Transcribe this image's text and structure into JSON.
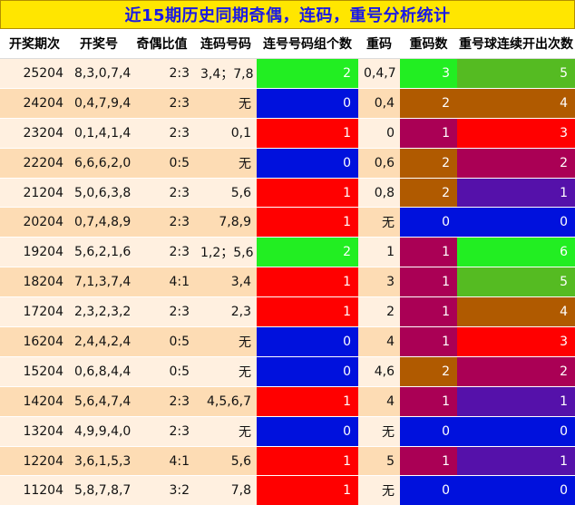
{
  "title": "近15期历史同期奇偶，连码，重号分析统计",
  "headers": [
    "开奖期次",
    "开奖号",
    "奇偶比值",
    "连码号码",
    "连号号码组个数",
    "重码",
    "重码数",
    "重号球连续开出次数"
  ],
  "colors": {
    "green": "#22ee22",
    "blue": "#0011dd",
    "red": "#ff0000",
    "brown": "#b05a00",
    "magenta": "#aa0055",
    "purple": "#5511aa",
    "lime": "#55bb22",
    "title_bg": "#ffe600",
    "title_text": "#1a1ae6"
  },
  "rows": [
    {
      "issue": "25204",
      "numbers": "8,3,0,7,4",
      "ratio": "2:3",
      "consec": "3,4；7,8",
      "groups": "2",
      "repeat": "0,4,7",
      "repeat_count": "3",
      "streak": "5",
      "groups_color": "#22ee22",
      "count_color": "#22ee22",
      "streak_color": "#55bb22"
    },
    {
      "issue": "24204",
      "numbers": "0,4,7,9,4",
      "ratio": "2:3",
      "consec": "无",
      "groups": "0",
      "repeat": "0,4",
      "repeat_count": "2",
      "streak": "4",
      "groups_color": "#0011dd",
      "count_color": "#b05a00",
      "streak_color": "#b05a00"
    },
    {
      "issue": "23204",
      "numbers": "0,1,4,1,4",
      "ratio": "2:3",
      "consec": "0,1",
      "groups": "1",
      "repeat": "0",
      "repeat_count": "1",
      "streak": "3",
      "groups_color": "#ff0000",
      "count_color": "#aa0055",
      "streak_color": "#ff0000"
    },
    {
      "issue": "22204",
      "numbers": "6,6,6,2,0",
      "ratio": "0:5",
      "consec": "无",
      "groups": "0",
      "repeat": "0,6",
      "repeat_count": "2",
      "streak": "2",
      "groups_color": "#0011dd",
      "count_color": "#b05a00",
      "streak_color": "#aa0055"
    },
    {
      "issue": "21204",
      "numbers": "5,0,6,3,8",
      "ratio": "2:3",
      "consec": "5,6",
      "groups": "1",
      "repeat": "0,8",
      "repeat_count": "2",
      "streak": "1",
      "groups_color": "#ff0000",
      "count_color": "#b05a00",
      "streak_color": "#5511aa"
    },
    {
      "issue": "20204",
      "numbers": "0,7,4,8,9",
      "ratio": "2:3",
      "consec": "7,8,9",
      "groups": "1",
      "repeat": "无",
      "repeat_count": "0",
      "streak": "0",
      "groups_color": "#ff0000",
      "count_color": "#0011dd",
      "streak_color": "#0011dd"
    },
    {
      "issue": "19204",
      "numbers": "5,6,2,1,6",
      "ratio": "2:3",
      "consec": "1,2；5,6",
      "groups": "2",
      "repeat": "1",
      "repeat_count": "1",
      "streak": "6",
      "groups_color": "#22ee22",
      "count_color": "#aa0055",
      "streak_color": "#22ee22"
    },
    {
      "issue": "18204",
      "numbers": "7,1,3,7,4",
      "ratio": "4:1",
      "consec": "3,4",
      "groups": "1",
      "repeat": "3",
      "repeat_count": "1",
      "streak": "5",
      "groups_color": "#ff0000",
      "count_color": "#aa0055",
      "streak_color": "#55bb22"
    },
    {
      "issue": "17204",
      "numbers": "2,3,2,3,2",
      "ratio": "2:3",
      "consec": "2,3",
      "groups": "1",
      "repeat": "2",
      "repeat_count": "1",
      "streak": "4",
      "groups_color": "#ff0000",
      "count_color": "#aa0055",
      "streak_color": "#b05a00"
    },
    {
      "issue": "16204",
      "numbers": "2,4,4,2,4",
      "ratio": "0:5",
      "consec": "无",
      "groups": "0",
      "repeat": "4",
      "repeat_count": "1",
      "streak": "3",
      "groups_color": "#0011dd",
      "count_color": "#aa0055",
      "streak_color": "#ff0000"
    },
    {
      "issue": "15204",
      "numbers": "0,6,8,4,4",
      "ratio": "0:5",
      "consec": "无",
      "groups": "0",
      "repeat": "4,6",
      "repeat_count": "2",
      "streak": "2",
      "groups_color": "#0011dd",
      "count_color": "#b05a00",
      "streak_color": "#aa0055"
    },
    {
      "issue": "14204",
      "numbers": "5,6,4,7,4",
      "ratio": "2:3",
      "consec": "4,5,6,7",
      "groups": "1",
      "repeat": "4",
      "repeat_count": "1",
      "streak": "1",
      "groups_color": "#ff0000",
      "count_color": "#aa0055",
      "streak_color": "#5511aa"
    },
    {
      "issue": "13204",
      "numbers": "4,9,9,4,0",
      "ratio": "2:3",
      "consec": "无",
      "groups": "0",
      "repeat": "无",
      "repeat_count": "0",
      "streak": "0",
      "groups_color": "#0011dd",
      "count_color": "#0011dd",
      "streak_color": "#0011dd"
    },
    {
      "issue": "12204",
      "numbers": "3,6,1,5,3",
      "ratio": "4:1",
      "consec": "5,6",
      "groups": "1",
      "repeat": "5",
      "repeat_count": "1",
      "streak": "1",
      "groups_color": "#ff0000",
      "count_color": "#aa0055",
      "streak_color": "#5511aa"
    },
    {
      "issue": "11204",
      "numbers": "5,8,7,8,7",
      "ratio": "3:2",
      "consec": "7,8",
      "groups": "1",
      "repeat": "无",
      "repeat_count": "0",
      "streak": "0",
      "groups_color": "#ff0000",
      "count_color": "#0011dd",
      "streak_color": "#0011dd"
    }
  ]
}
